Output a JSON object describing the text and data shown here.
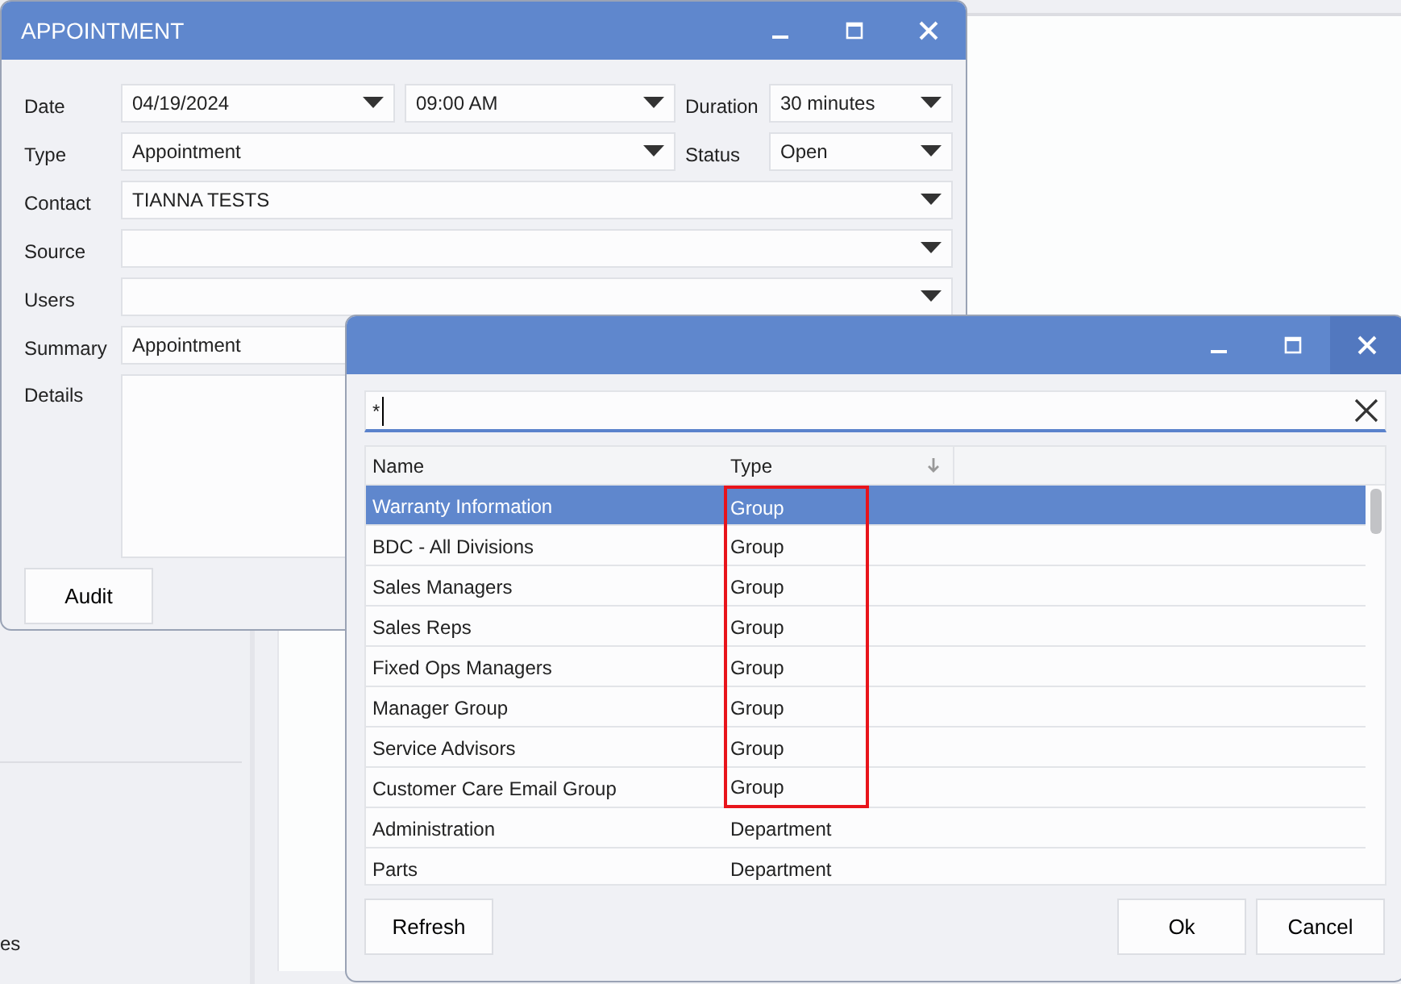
{
  "background": {
    "side_text": "es"
  },
  "appointment_window": {
    "title": "APPOINTMENT",
    "date": {
      "label": "Date",
      "value": "04/19/2024"
    },
    "time": {
      "value": "09:00 AM"
    },
    "duration": {
      "label": "Duration",
      "value": "30 minutes"
    },
    "type": {
      "label": "Type",
      "value": "Appointment"
    },
    "status": {
      "label": "Status",
      "value": "Open"
    },
    "contact": {
      "label": "Contact",
      "value": "TIANNA TESTS"
    },
    "source": {
      "label": "Source"
    },
    "users": {
      "label": "Users"
    },
    "summary": {
      "label": "Summary",
      "value": "Appointment"
    },
    "details": {
      "label": "Details"
    },
    "buttons": [
      "Audit"
    ]
  },
  "picker_window": {
    "search": {
      "value": "*"
    },
    "columns": [
      {
        "label": "Name",
        "sorted": false
      },
      {
        "label": "Type",
        "sorted": true
      }
    ],
    "rows": [
      {
        "name": "Warranty Information",
        "type": "Group",
        "selected": true,
        "highlighted": true
      },
      {
        "name": "BDC - All Divisions",
        "type": "Group",
        "selected": false,
        "highlighted": true
      },
      {
        "name": "Sales Managers",
        "type": "Group",
        "selected": false,
        "highlighted": true
      },
      {
        "name": "Sales Reps",
        "type": "Group",
        "selected": false,
        "highlighted": true
      },
      {
        "name": "Fixed Ops Managers",
        "type": "Group",
        "selected": false,
        "highlighted": true
      },
      {
        "name": "Manager Group",
        "type": "Group",
        "selected": false,
        "highlighted": true
      },
      {
        "name": "Service Advisors",
        "type": "Group",
        "selected": false,
        "highlighted": true
      },
      {
        "name": "Customer Care Email Group",
        "type": "Group",
        "selected": false,
        "highlighted": true
      },
      {
        "name": "Administration",
        "type": "Department",
        "selected": false,
        "highlighted": false
      },
      {
        "name": "Parts",
        "type": "Department",
        "selected": false,
        "highlighted": false
      }
    ],
    "left_buttons": [
      "Refresh"
    ],
    "right_buttons": [
      "Ok",
      "Cancel"
    ]
  }
}
